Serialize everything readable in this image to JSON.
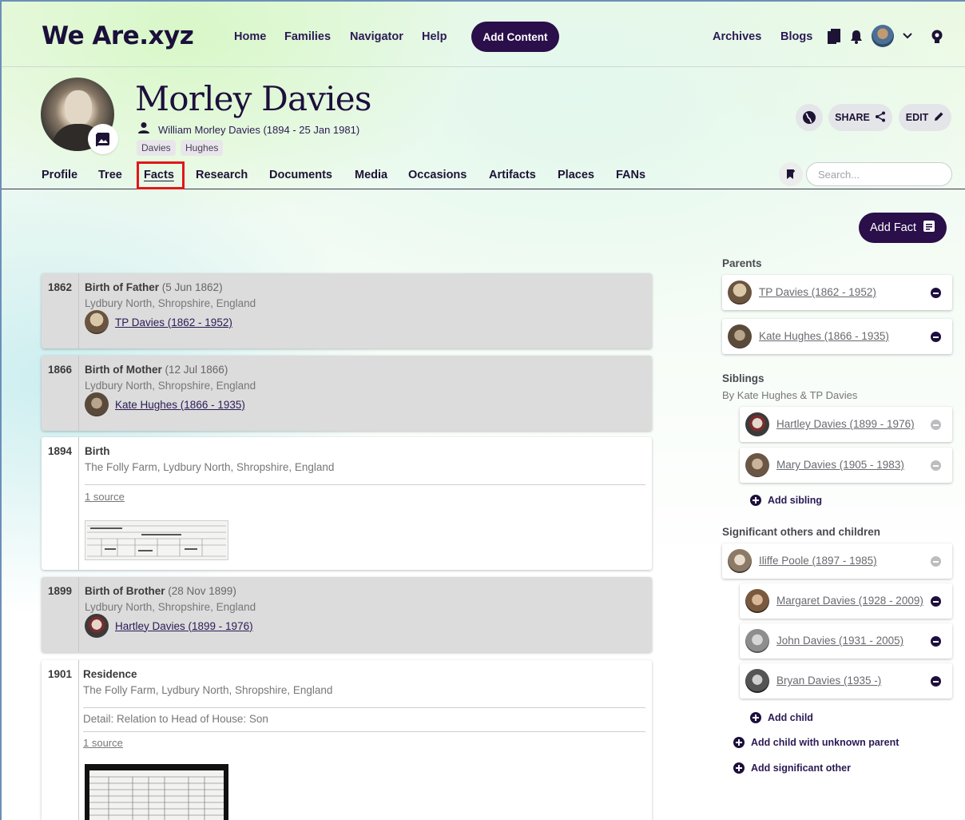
{
  "topnav": {
    "logo": "We Are.xyz",
    "links": [
      "Home",
      "Families",
      "Navigator",
      "Help"
    ],
    "add_content": "Add Content",
    "right_links": [
      "Archives",
      "Blogs"
    ]
  },
  "profile": {
    "name": "Morley Davies",
    "full_name": "William Morley Davies (1894 - 25 Jan 1981)",
    "tags": [
      "Davies",
      "Hughes"
    ],
    "share_label": "SHARE",
    "edit_label": "EDIT"
  },
  "tabs": [
    "Profile",
    "Tree",
    "Facts",
    "Research",
    "Documents",
    "Media",
    "Occasions",
    "Artifacts",
    "Places",
    "FANs"
  ],
  "active_tab": "Facts",
  "search": {
    "placeholder": "Search..."
  },
  "add_fact_label": "Add Fact",
  "facts": [
    {
      "year": "1862",
      "title": "Birth of Father",
      "date": "(5 Jun 1862)",
      "place": "Lydbury North, Shropshire, England",
      "person": "TP Davies (1862 - 1952)"
    },
    {
      "year": "1866",
      "title": "Birth of Mother",
      "date": "(12 Jul 1866)",
      "place": "Lydbury North, Shropshire, England",
      "person": "Kate Hughes (1866 - 1935)"
    },
    {
      "year": "1894",
      "title": "Birth",
      "place": "The Folly Farm, Lydbury North, Shropshire, England",
      "source": "1 source"
    },
    {
      "year": "1899",
      "title": "Birth of Brother",
      "date": "(28 Nov 1899)",
      "place": "Lydbury North, Shropshire, England",
      "person": "Hartley Davies (1899 - 1976)"
    },
    {
      "year": "1901",
      "title": "Residence",
      "place": "The Folly Farm, Lydbury North, Shropshire, England",
      "detail": "Detail: Relation to Head of House: Son",
      "source": "1 source"
    }
  ],
  "sidebar": {
    "parents_heading": "Parents",
    "parents": [
      "TP Davies (1862 - 1952)",
      "Kate Hughes (1866 - 1935)"
    ],
    "siblings_heading": "Siblings",
    "siblings_sub": "By Kate Hughes & TP Davies",
    "siblings": [
      "Hartley Davies (1899 - 1976)",
      "Mary Davies (1905 - 1983)"
    ],
    "add_sibling": "Add sibling",
    "others_heading": "Significant others and children",
    "spouse": "Iliffe Poole (1897 - 1985)",
    "children": [
      "Margaret Davies (1928 - 2009)",
      "John Davies (1931 - 2005)",
      "Bryan Davies (1935 -)"
    ],
    "add_child": "Add child",
    "add_child_unknown": "Add child with unknown parent",
    "add_significant_other": "Add significant other"
  }
}
